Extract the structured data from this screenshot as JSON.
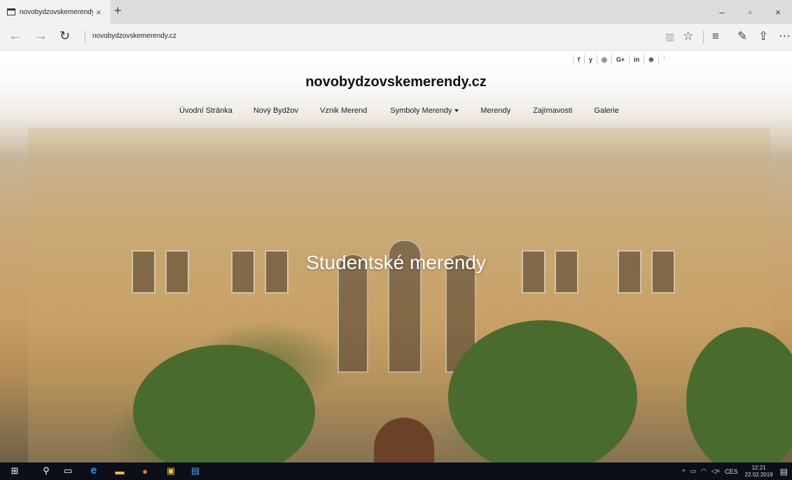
{
  "browser": {
    "tab_title": "novobydzovskemerendy.cz",
    "url": "novobydzovskemerendy.cz",
    "new_tab_symbol": "+",
    "window_controls": [
      "–",
      "▫",
      "×"
    ]
  },
  "site": {
    "title": "novobydzovskemerendy.cz",
    "social": [
      "f",
      "y",
      "◎",
      "G+",
      "in",
      "⊛",
      "ʾ"
    ],
    "menu": [
      {
        "label": "Úvodní Stránka"
      },
      {
        "label": "Nový Bydžov"
      },
      {
        "label": "Vznik Merend"
      },
      {
        "label": "Symboly Merendy",
        "dropdown": true
      },
      {
        "label": "Merendy"
      },
      {
        "label": "Zajímavosti"
      },
      {
        "label": "Galerie"
      }
    ],
    "hero_text": "Studentské merendy"
  },
  "taskbar": {
    "language": "CES",
    "time": "12:21",
    "date": "22.02.2019"
  },
  "colors": {
    "taskbar": "#0c0f1a",
    "chrome": "#f2f2f2",
    "tabbar": "#dcdcdc"
  }
}
